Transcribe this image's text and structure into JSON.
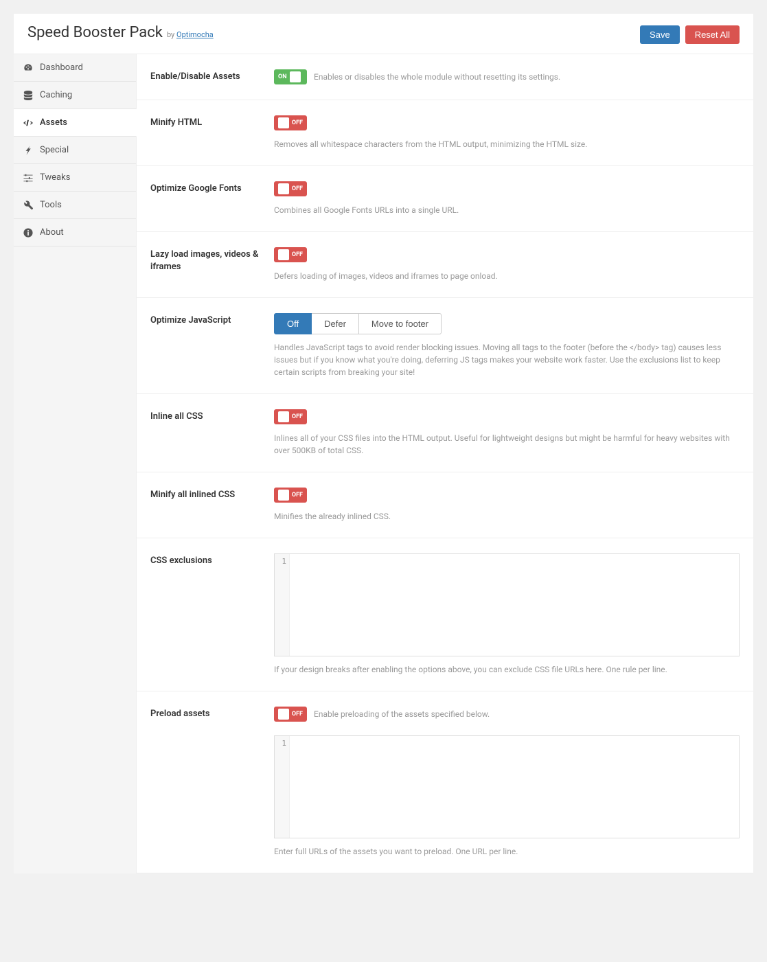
{
  "header": {
    "title": "Speed Booster Pack",
    "by_prefix": "by ",
    "by_link": "Optimocha",
    "save": "Save",
    "reset": "Reset All"
  },
  "nav": {
    "dashboard": "Dashboard",
    "caching": "Caching",
    "assets": "Assets",
    "special": "Special",
    "tweaks": "Tweaks",
    "tools": "Tools",
    "about": "About"
  },
  "toggle": {
    "on": "ON",
    "off": "OFF"
  },
  "rows": {
    "enable": {
      "label": "Enable/Disable Assets",
      "desc": "Enables or disables the whole module without resetting its settings."
    },
    "minify_html": {
      "label": "Minify HTML",
      "desc": "Removes all whitespace characters from the HTML output, minimizing the HTML size."
    },
    "google_fonts": {
      "label": "Optimize Google Fonts",
      "desc": "Combines all Google Fonts URLs into a single URL."
    },
    "lazy": {
      "label": "Lazy load images, videos & iframes",
      "desc": "Defers loading of images, videos and iframes to page onload."
    },
    "optimize_js": {
      "label": "Optimize JavaScript",
      "opt_off": "Off",
      "opt_defer": "Defer",
      "opt_footer": "Move to footer",
      "desc": "Handles JavaScript tags to avoid render blocking issues. Moving all tags to the footer (before the </body> tag) causes less issues but if you know what you're doing, deferring JS tags makes your website work faster. Use the exclusions list to keep certain scripts from breaking your site!"
    },
    "inline_css": {
      "label": "Inline all CSS",
      "desc": "Inlines all of your CSS files into the HTML output. Useful for lightweight designs but might be harmful for heavy websites with over 500KB of total CSS."
    },
    "minify_css": {
      "label": "Minify all inlined CSS",
      "desc": "Minifies the already inlined CSS."
    },
    "css_exclusions": {
      "label": "CSS exclusions",
      "line": "1",
      "desc": "If your design breaks after enabling the options above, you can exclude CSS file URLs here. One rule per line."
    },
    "preload": {
      "label": "Preload assets",
      "inline_desc": "Enable preloading of the assets specified below.",
      "line": "1",
      "desc": "Enter full URLs of the assets you want to preload. One URL per line."
    }
  }
}
